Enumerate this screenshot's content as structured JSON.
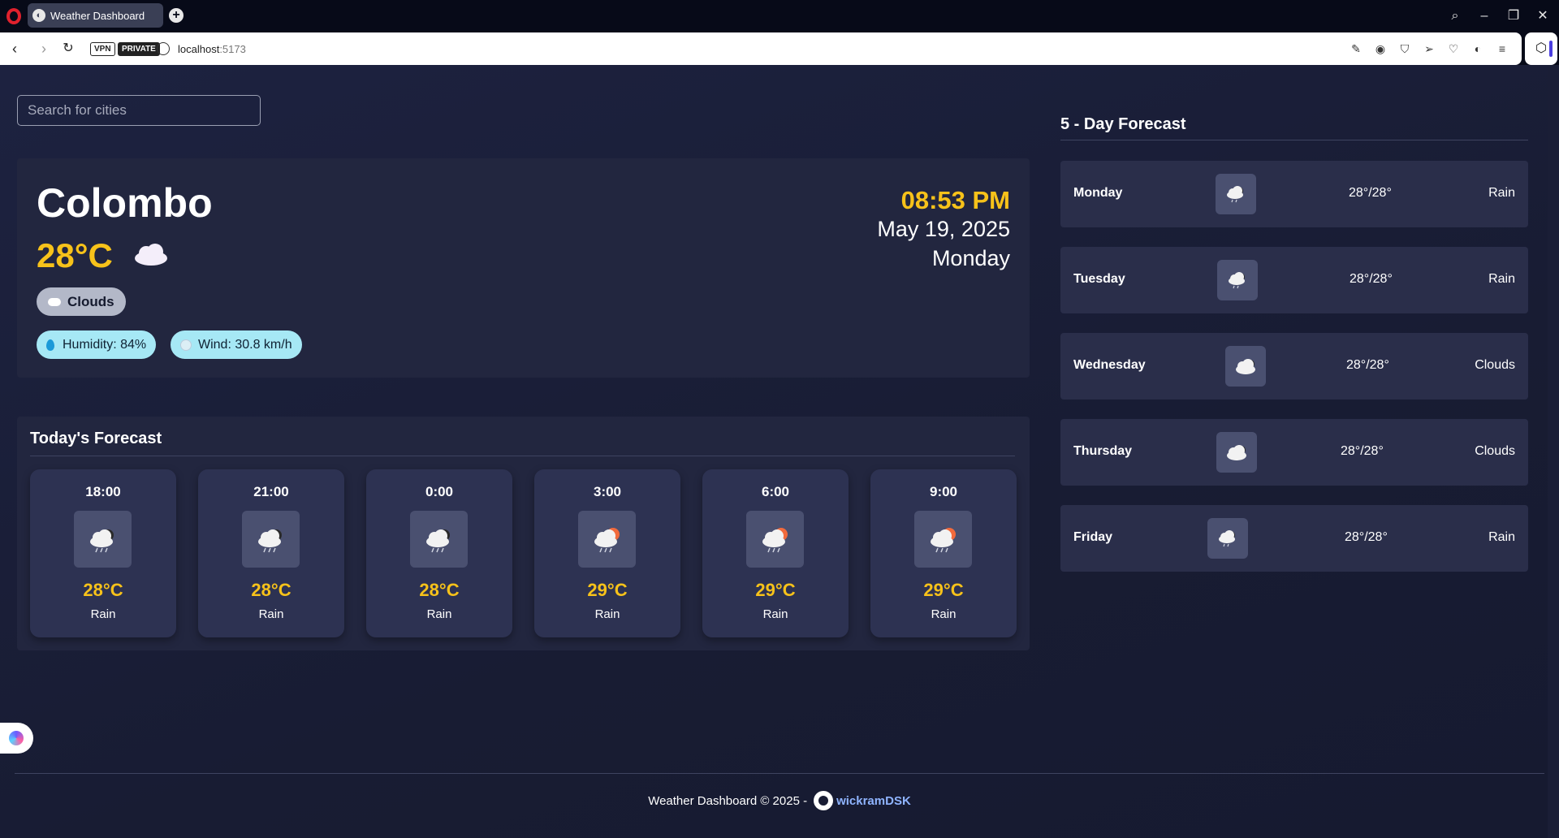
{
  "browser": {
    "tab_title": "Weather Dashboard",
    "url_host": "localhost",
    "url_port": ":5173",
    "vpn_label": "VPN",
    "private_label": "PRIVATE"
  },
  "search": {
    "placeholder": "Search for cities"
  },
  "current": {
    "city": "Colombo",
    "temp": "28°C",
    "condition": "Clouds",
    "humidity": "Humidity: 84%",
    "wind": "Wind: 30.8 km/h",
    "time": "08:53 PM",
    "date": "May 19, 2025",
    "day": "Monday",
    "icon": "cloud-icon"
  },
  "today": {
    "title": "Today's Forecast",
    "hours": [
      {
        "time": "18:00",
        "temp": "28°C",
        "desc": "Rain",
        "icon": "rain-cloud-icon"
      },
      {
        "time": "21:00",
        "temp": "28°C",
        "desc": "Rain",
        "icon": "rain-cloud-icon"
      },
      {
        "time": "0:00",
        "temp": "28°C",
        "desc": "Rain",
        "icon": "rain-cloud-icon"
      },
      {
        "time": "3:00",
        "temp": "29°C",
        "desc": "Rain",
        "icon": "sun-rain-cloud-icon"
      },
      {
        "time": "6:00",
        "temp": "29°C",
        "desc": "Rain",
        "icon": "sun-rain-cloud-icon"
      },
      {
        "time": "9:00",
        "temp": "29°C",
        "desc": "Rain",
        "icon": "sun-rain-cloud-icon"
      }
    ]
  },
  "forecast": {
    "title": "5 - Day Forecast",
    "days": [
      {
        "day": "Monday",
        "temp": "28°/28°",
        "desc": "Rain",
        "icon": "rain-cloud-icon"
      },
      {
        "day": "Tuesday",
        "temp": "28°/28°",
        "desc": "Rain",
        "icon": "rain-cloud-icon"
      },
      {
        "day": "Wednesday",
        "temp": "28°/28°",
        "desc": "Clouds",
        "icon": "cloud-icon"
      },
      {
        "day": "Thursday",
        "temp": "28°/28°",
        "desc": "Clouds",
        "icon": "cloud-icon"
      },
      {
        "day": "Friday",
        "temp": "28°/28°",
        "desc": "Rain",
        "icon": "rain-cloud-icon"
      }
    ]
  },
  "footer": {
    "text": "Weather Dashboard © 2025 -",
    "author": "wickramDSK"
  },
  "colors": {
    "accent": "#f7c21a",
    "background": "#1b1f38",
    "card": "#22263f",
    "badge_info": "#a6e8f5"
  }
}
